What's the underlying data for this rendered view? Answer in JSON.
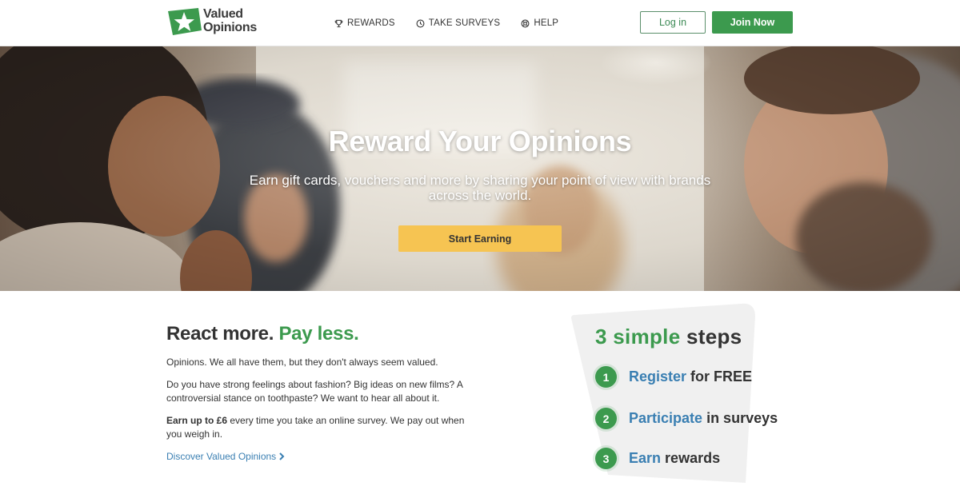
{
  "brand": {
    "logo_line1": "Valued",
    "logo_line2": "Opinions",
    "logo_icon": "star-icon",
    "colors": {
      "green": "#3c9a4e",
      "yellow": "#f6c452",
      "blue": "#3a7fb2",
      "text": "#333333"
    }
  },
  "nav": {
    "items": [
      {
        "label": "REWARDS",
        "icon": "trophy-icon"
      },
      {
        "label": "TAKE SURVEYS",
        "icon": "clock-icon"
      },
      {
        "label": "HELP",
        "icon": "help-ring-icon"
      }
    ],
    "login_label": "Log in",
    "join_label": "Join Now"
  },
  "hero": {
    "title": "Reward Your Opinions",
    "subtitle": "Earn gift cards, vouchers and more by sharing your point of view with brands across the world.",
    "cta_label": "Start Earning"
  },
  "intro": {
    "title_part1": "React more.",
    "title_part2": "Pay less.",
    "para1": "Opinions. We all have them, but they don't always seem valued.",
    "para2": "Do you have strong feelings about fashion? Big ideas on new films? A controversial stance on toothpaste? We want to hear all about it.",
    "para3_bold": "Earn up to £6",
    "para3_rest": "every time you take an online survey. We pay out when you weigh in.",
    "link_label": "Discover Valued Opinions"
  },
  "steps": {
    "title_num": "3 simple",
    "title_word": "steps",
    "items": [
      {
        "number": "1",
        "highlight": "Register",
        "rest": "for FREE"
      },
      {
        "number": "2",
        "highlight": "Participate",
        "rest": "in surveys"
      },
      {
        "number": "3",
        "highlight": "Earn",
        "rest": "rewards"
      }
    ]
  }
}
